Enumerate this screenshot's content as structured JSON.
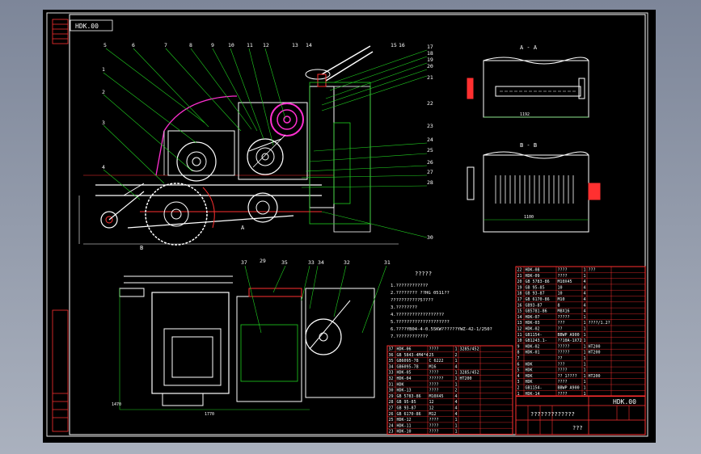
{
  "drawing": {
    "stamp": "HDK.00",
    "part_number": "HDK.00",
    "sheet_title": "?????????????",
    "company": "???",
    "section_a": "A - A",
    "section_b": "B - B",
    "view_a": "A",
    "view_b": "B",
    "balloons_left": [
      "5",
      "6",
      "7",
      "8",
      "9",
      "10",
      "11",
      "12"
    ],
    "balloons_right": [
      "13",
      "14",
      "15",
      "16",
      "17",
      "18",
      "19",
      "20"
    ],
    "balloons_side": [
      "1",
      "2",
      "3",
      "4"
    ],
    "balloons_mid": [
      "21",
      "22",
      "23",
      "24",
      "25",
      "26",
      "27",
      "28",
      "29",
      "30"
    ],
    "balloons_plan": [
      "37",
      "35",
      "33",
      "34",
      "32",
      "31"
    ],
    "dimensions": {
      "overall_length": "1770",
      "width_plan": "1770",
      "height": "1470",
      "a_width": "1192",
      "b_width": "1100"
    },
    "notes_title": "?????",
    "notes": [
      "1.????????????",
      "2.???????? ??HG 0511??",
      "  ???????????5????",
      "3.????????",
      "4.??????????????????",
      "5.????????????????????",
      "6.????YB04-4-0.55KW??????YWZ-42-1/250?",
      "7.????????????"
    ]
  },
  "bom_left": [
    [
      "37",
      "HDK-06",
      "????",
      "1",
      "3285/452",
      ""
    ],
    [
      "36",
      "GB 5843-4M4*4",
      "25",
      "2",
      "",
      ""
    ],
    [
      "35",
      "GB6095-78",
      "C 6222",
      "1",
      "",
      ""
    ],
    [
      "34",
      "GB6095-78",
      "M16",
      "4",
      "",
      ""
    ],
    [
      "33",
      "HDK-05",
      "????",
      "1",
      "3285/452",
      ""
    ],
    [
      "32",
      "HDK-04",
      "??????",
      "1",
      "HT200",
      ""
    ],
    [
      "31",
      "HDK",
      "????",
      "1",
      "",
      ""
    ],
    [
      "30",
      "HDK-13",
      "????",
      "2",
      "",
      ""
    ],
    [
      "29",
      "GB 5783-86",
      "M10X45",
      "4",
      "",
      ""
    ],
    [
      "28",
      "GB 95-85",
      "12",
      "4",
      "",
      ""
    ],
    [
      "27",
      "GB 93-87",
      "12",
      "4",
      "",
      ""
    ],
    [
      "26",
      "GB 6170-86",
      "M12",
      "4",
      "",
      ""
    ],
    [
      "25",
      "HDK-12",
      "????",
      "1",
      "",
      ""
    ],
    [
      "24",
      "HDK-11",
      "????",
      "1",
      "",
      ""
    ],
    [
      "23",
      "HDK-10",
      "????",
      "1",
      "",
      ""
    ]
  ],
  "bom_right": [
    [
      "22",
      "HDK-08",
      "????",
      "1",
      "???",
      ""
    ],
    [
      "21",
      "HDK-09",
      "????",
      "1",
      "",
      ""
    ],
    [
      "20",
      "GB 5783-86",
      "M10X45",
      "4",
      "",
      ""
    ],
    [
      "19",
      "GB 95-85",
      "10",
      "4",
      "",
      ""
    ],
    [
      "18",
      "GB 93-87",
      "10",
      "4",
      "",
      ""
    ],
    [
      "17",
      "GB 6170-86",
      "M10",
      "4",
      "",
      ""
    ],
    [
      "16",
      "GB93-87",
      "8",
      "4",
      "",
      ""
    ],
    [
      "15",
      "GB5781-86",
      "M8X16",
      "4",
      "",
      ""
    ],
    [
      "14",
      "HDK-07",
      "?????",
      "1",
      "",
      ""
    ],
    [
      "13",
      "HDK-03",
      "???",
      "1",
      "????/1.2?",
      ""
    ],
    [
      "12",
      "HDK-02",
      "??",
      "1",
      "",
      ""
    ],
    [
      "11",
      "GB1154-",
      "BBWP A900",
      "1",
      "",
      ""
    ],
    [
      "10",
      "GB1243.1-",
      "??10A-1X72",
      "1",
      "",
      ""
    ],
    [
      "9",
      "HDK-02",
      "?????",
      "1",
      "HT200",
      ""
    ],
    [
      "8",
      "HDK-01",
      "?????",
      "1",
      "HT200",
      ""
    ],
    [
      "7",
      "",
      "??",
      "1",
      "",
      ""
    ],
    [
      "6",
      "HDK",
      "???",
      "1",
      "",
      ""
    ],
    [
      "5",
      "HDK",
      "????",
      "1",
      "",
      ""
    ],
    [
      "4",
      "HDK",
      "?? 1????",
      "1",
      "HT200",
      ""
    ],
    [
      "3",
      "HDK",
      "????",
      "1",
      "",
      ""
    ],
    [
      "2",
      "GB1154-",
      "BBWP A900",
      "1",
      "",
      ""
    ],
    [
      "1",
      "HDK-14",
      "????",
      "1",
      "",
      ""
    ]
  ]
}
